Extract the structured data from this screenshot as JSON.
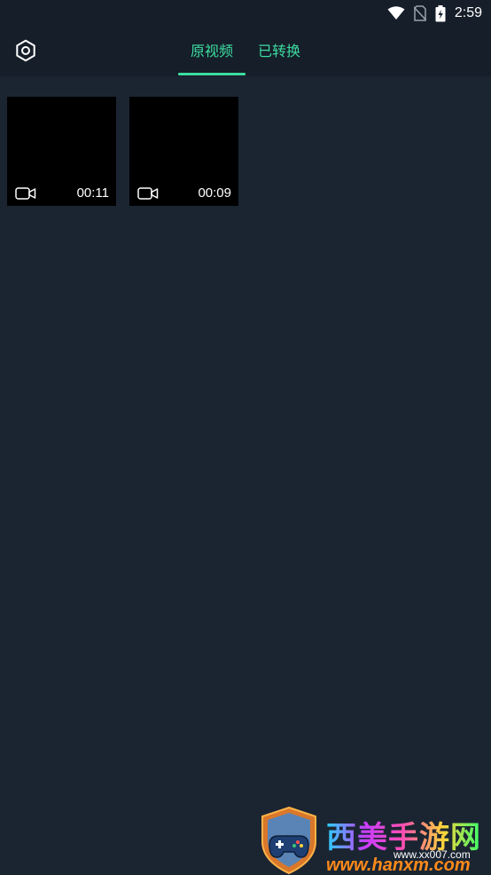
{
  "status_bar": {
    "time": "2:59",
    "icons": [
      "wifi-icon",
      "no-sim-icon",
      "battery-charging-icon"
    ]
  },
  "header": {
    "settings_icon": "settings-hexagon-icon",
    "tabs": [
      {
        "label": "原视频",
        "active": true
      },
      {
        "label": "已转换",
        "active": false
      }
    ]
  },
  "videos": [
    {
      "duration": "00:11",
      "icon": "video-camera-icon"
    },
    {
      "duration": "00:09",
      "icon": "video-camera-icon"
    }
  ],
  "watermark": {
    "title": "西美手游网",
    "url": "www.hanxm.com",
    "sub": "www.xx007.com"
  },
  "colors": {
    "background": "#1b2532",
    "header": "#151e29",
    "accent": "#3ddca0"
  }
}
